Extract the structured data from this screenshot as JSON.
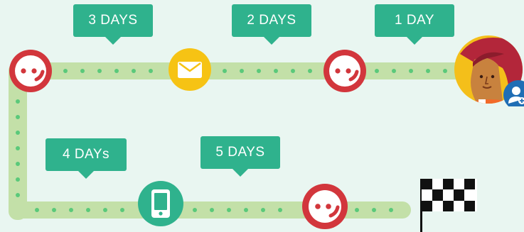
{
  "bubbles": {
    "b1": "3 DAYS",
    "b2": "2 DAYS",
    "b3": "1 DAY",
    "b4": "4 DAYs",
    "b5": "5 DAYS"
  },
  "icons": {
    "chat": "chat-face-icon",
    "email": "envelope-icon",
    "phone": "smartphone-icon",
    "avatar": "person-avatar",
    "badge": "add-user-icon",
    "finish": "checkered-flag-icon"
  },
  "colors": {
    "background": "#e9f6f1",
    "track": "#c3e0a8",
    "dots": "#5ac97a",
    "bubble": "#2fb28d",
    "chat": "#d2363c",
    "email": "#f6c314",
    "phone": "#2fb28d",
    "badge": "#1f6eb5"
  }
}
